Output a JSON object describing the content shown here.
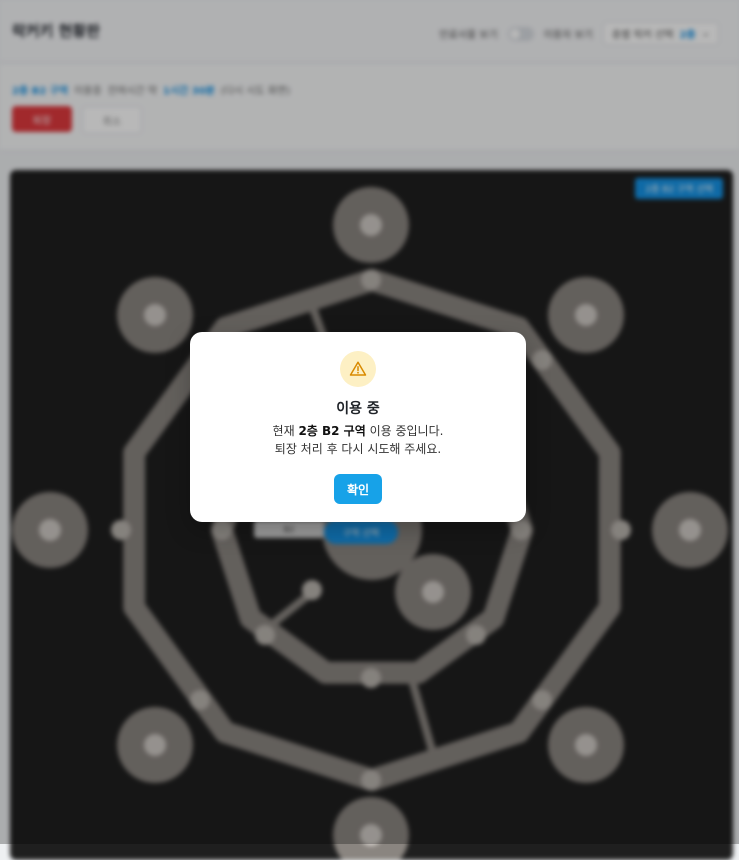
{
  "header": {
    "title": "락커키 현황판",
    "show_label": "만료사물 보기",
    "toggle_label": "이용자 보기",
    "floor_label": "층별 락커 선택",
    "floor_value": "2층"
  },
  "infobar": {
    "selected": "2층 B2 구역",
    "status": "이용중",
    "time_label": "잔여시간 약",
    "time_value": "1시간 30분",
    "time_note": "(다시 시도 화면)",
    "exit_label": "퇴장",
    "cancel_label": "취소"
  },
  "map": {
    "badge": "2층 B2 구역 선택",
    "chip_left": "B2",
    "chip_right": "구역 선택"
  },
  "modal": {
    "icon": "warning-icon",
    "title": "이용 중",
    "line1_prefix": "현재 ",
    "line1_bold": "2층 B2 구역",
    "line1_suffix": " 이용 중입니다.",
    "line2": "퇴장 처리 후 다시 시도해 주세요.",
    "ok_label": "확인"
  },
  "colors": {
    "accent": "#17a2e8",
    "danger": "#e0393e",
    "warning_bg": "#fdf0c4",
    "warning_fg": "#d98a00",
    "map_bg": "#1f1f1f",
    "track": "#8a8580"
  }
}
